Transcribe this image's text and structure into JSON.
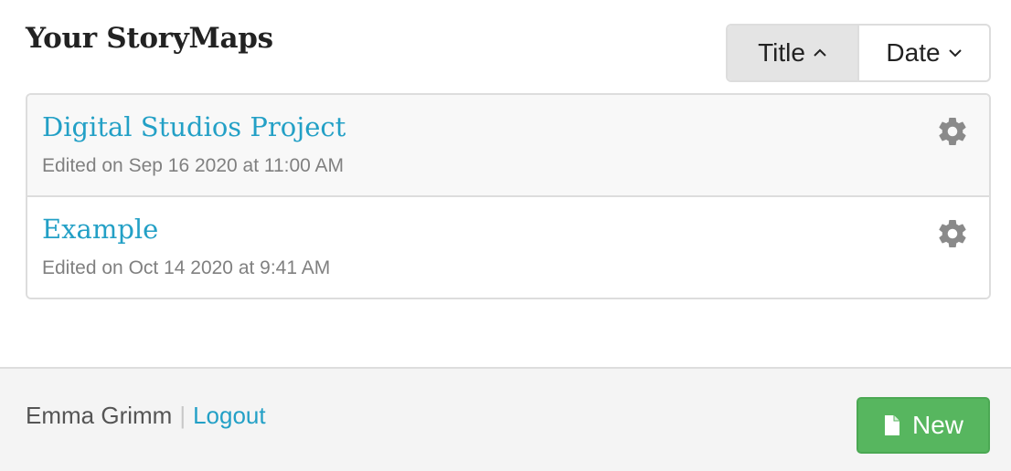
{
  "header": {
    "title": "Your StoryMaps"
  },
  "sort": {
    "title_label": "Title",
    "date_label": "Date",
    "active": "Title"
  },
  "storymaps": [
    {
      "title": "Digital Studios Project",
      "edited": "Edited on Sep 16 2020 at 11:00 AM"
    },
    {
      "title": "Example",
      "edited": "Edited on Oct 14 2020 at 9:41 AM"
    }
  ],
  "footer": {
    "user_name": "Emma Grimm",
    "separator": "|",
    "logout_label": "Logout",
    "new_label": "New"
  },
  "icons": {
    "sort_asc": "chevron-up-icon",
    "sort_desc": "chevron-down-icon",
    "settings": "gear-icon",
    "new": "document-icon"
  },
  "colors": {
    "link": "#23a0c6",
    "new_button": "#57b65f",
    "active_sort_bg": "#e4e4e4"
  }
}
